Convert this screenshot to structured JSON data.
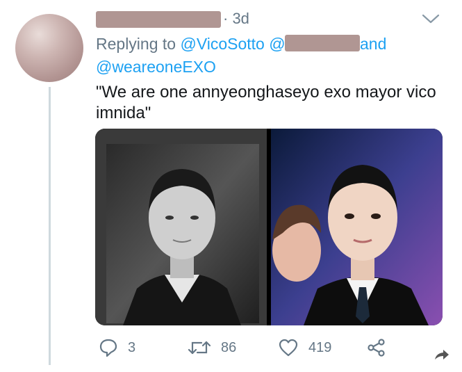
{
  "tweet": {
    "time": "· 3d",
    "reply_prefix": "Replying to",
    "mention_1": "@VicoSotto",
    "mention_2_prefix": "@",
    "and_text": "and",
    "mention_3": "@weareoneEXO",
    "text": "\"We are one annyeonghaseyo exo mayor vico imnida\""
  },
  "actions": {
    "reply_count": "3",
    "retweet_count": "86",
    "like_count": "419"
  },
  "colors": {
    "link": "#1da1f2",
    "muted": "#657786",
    "redaction": "#b09693"
  },
  "icons": {
    "reply": "reply-bubble-icon",
    "retweet": "retweet-icon",
    "like": "heart-icon",
    "share": "share-icon",
    "menu": "chevron-down-icon",
    "external_share": "forward-arrow-icon"
  }
}
